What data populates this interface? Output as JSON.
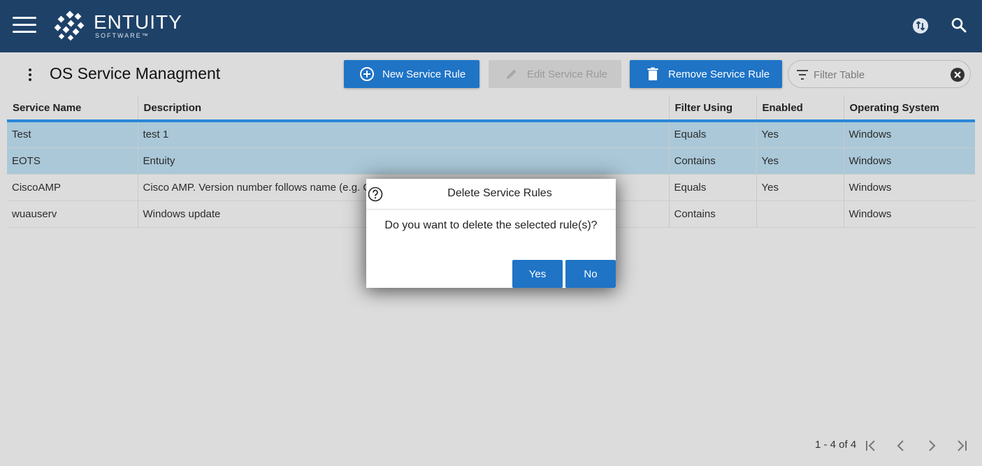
{
  "topbar": {
    "brand_name": "ENTUITY",
    "brand_sub": "SOFTWARE™",
    "icons": [
      "menu-icon",
      "entuity-logo",
      "sync-icon",
      "search-icon"
    ]
  },
  "page": {
    "title": "OS Service Managment"
  },
  "toolbar": {
    "new_label": "New Service Rule",
    "edit_label": "Edit Service Rule",
    "remove_label": "Remove Service Rule",
    "filter_placeholder": "Filter Table"
  },
  "table": {
    "columns": [
      "Service Name",
      "Description",
      "Filter Using",
      "Enabled",
      "Operating System"
    ],
    "rows": [
      {
        "name": "Test",
        "description": "test 1",
        "filter": "Equals",
        "enabled": "Yes",
        "os": "Windows",
        "selected": true
      },
      {
        "name": "EOTS",
        "description": "Entuity",
        "filter": "Contains",
        "enabled": "Yes",
        "os": "Windows",
        "selected": true
      },
      {
        "name": "CiscoAMP",
        "description": "Cisco AMP. Version number follows name (e.g. C",
        "filter": "Equals",
        "enabled": "Yes",
        "os": "Windows",
        "selected": false
      },
      {
        "name": "wuauserv",
        "description": "Windows update",
        "filter": "Contains",
        "enabled": "",
        "os": "Windows",
        "selected": false
      }
    ]
  },
  "pager": {
    "range": "1 - 4 of 4"
  },
  "dialog": {
    "title": "Delete Service Rules",
    "message": "Do you want to delete the selected rule(s)?",
    "yes_label": "Yes",
    "no_label": "No"
  },
  "colors": {
    "topbar": "#1e4168",
    "accent": "#1f74c6",
    "selected_row": "#aac8d8",
    "header_underline": "#2a87d8"
  }
}
